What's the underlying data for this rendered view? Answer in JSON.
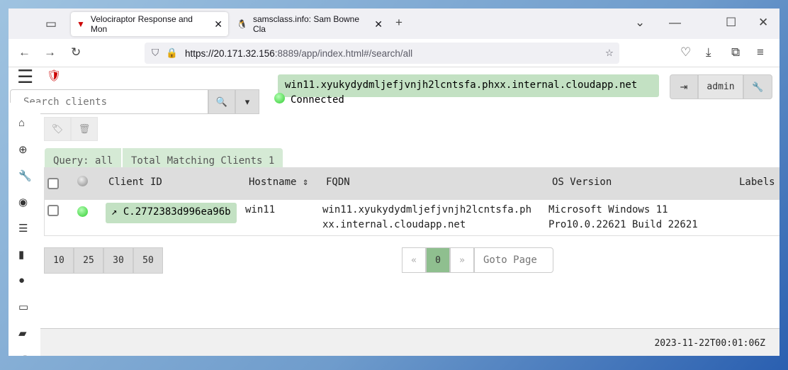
{
  "browser": {
    "tabs": [
      {
        "title": "Velociraptor Response and Mon"
      },
      {
        "title": "samsclass.info: Sam Bowne Cla"
      }
    ],
    "url_host": "https://20.171.32.156",
    "url_rest": ":8889/app/index.html#/search/all"
  },
  "header": {
    "search_placeholder": "Search clients",
    "hostname": "win11.xyukydydmljefjvnjh2lcntsfa.phxx.internal.cloudapp.net",
    "status": "Connected",
    "user": "admin"
  },
  "query": {
    "label": "Query: all",
    "total": "Total Matching Clients 1"
  },
  "table": {
    "columns": [
      "Client ID",
      "Hostname",
      "FQDN",
      "OS Version",
      "Labels"
    ],
    "rows": [
      {
        "client_id": "C.2772383d996ea96b",
        "hostname": "win11",
        "fqdn_1": "win11.xyukydydmljefjvnjh2lcntsfa.ph",
        "fqdn_2": "xx.internal.cloudapp.net",
        "os_1": "Microsoft Windows 11",
        "os_2": "Pro10.0.22621 Build 22621"
      }
    ]
  },
  "pagination": {
    "sizes": [
      "10",
      "25",
      "30",
      "50"
    ],
    "prev": "«",
    "page": "0",
    "next": "»",
    "goto_placeholder": "Goto Page"
  },
  "footer": {
    "timestamp": "2023-11-22T00:01:06Z"
  }
}
